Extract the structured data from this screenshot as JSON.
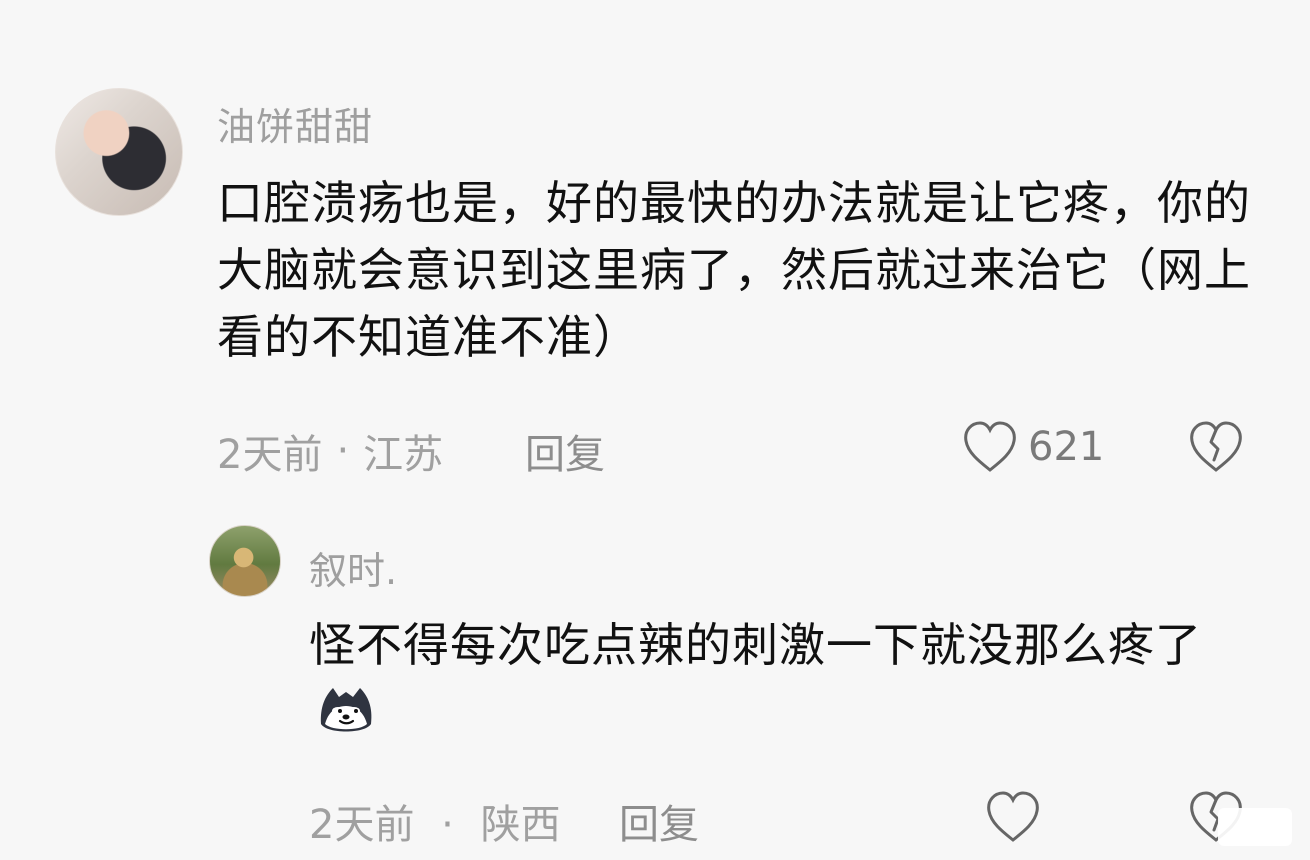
{
  "comments": [
    {
      "username": "油饼甜甜",
      "text": "口腔溃疡也是，好的最快的办法就是让它疼，你的大脑就会意识到这里病了，然后就过来治它（网上看的不知道准不准）",
      "time": "2天前",
      "location": "江苏",
      "reply_label": "回复",
      "likes": "621",
      "icons": {
        "like": "heart-icon",
        "dislike": "broken-heart-icon"
      }
    },
    {
      "username": "叙时.",
      "text": "怪不得每次吃点辣的刺激一下就没那么疼了",
      "time": "2天前",
      "location": "陕西",
      "reply_label": "回复",
      "likes": "",
      "emoji": "doge-emoji",
      "icons": {
        "like": "heart-icon",
        "dislike": "broken-heart-icon"
      }
    }
  ],
  "colors": {
    "background": "#f7f7f7",
    "text": "#111111",
    "muted": "#9f9f9f"
  }
}
